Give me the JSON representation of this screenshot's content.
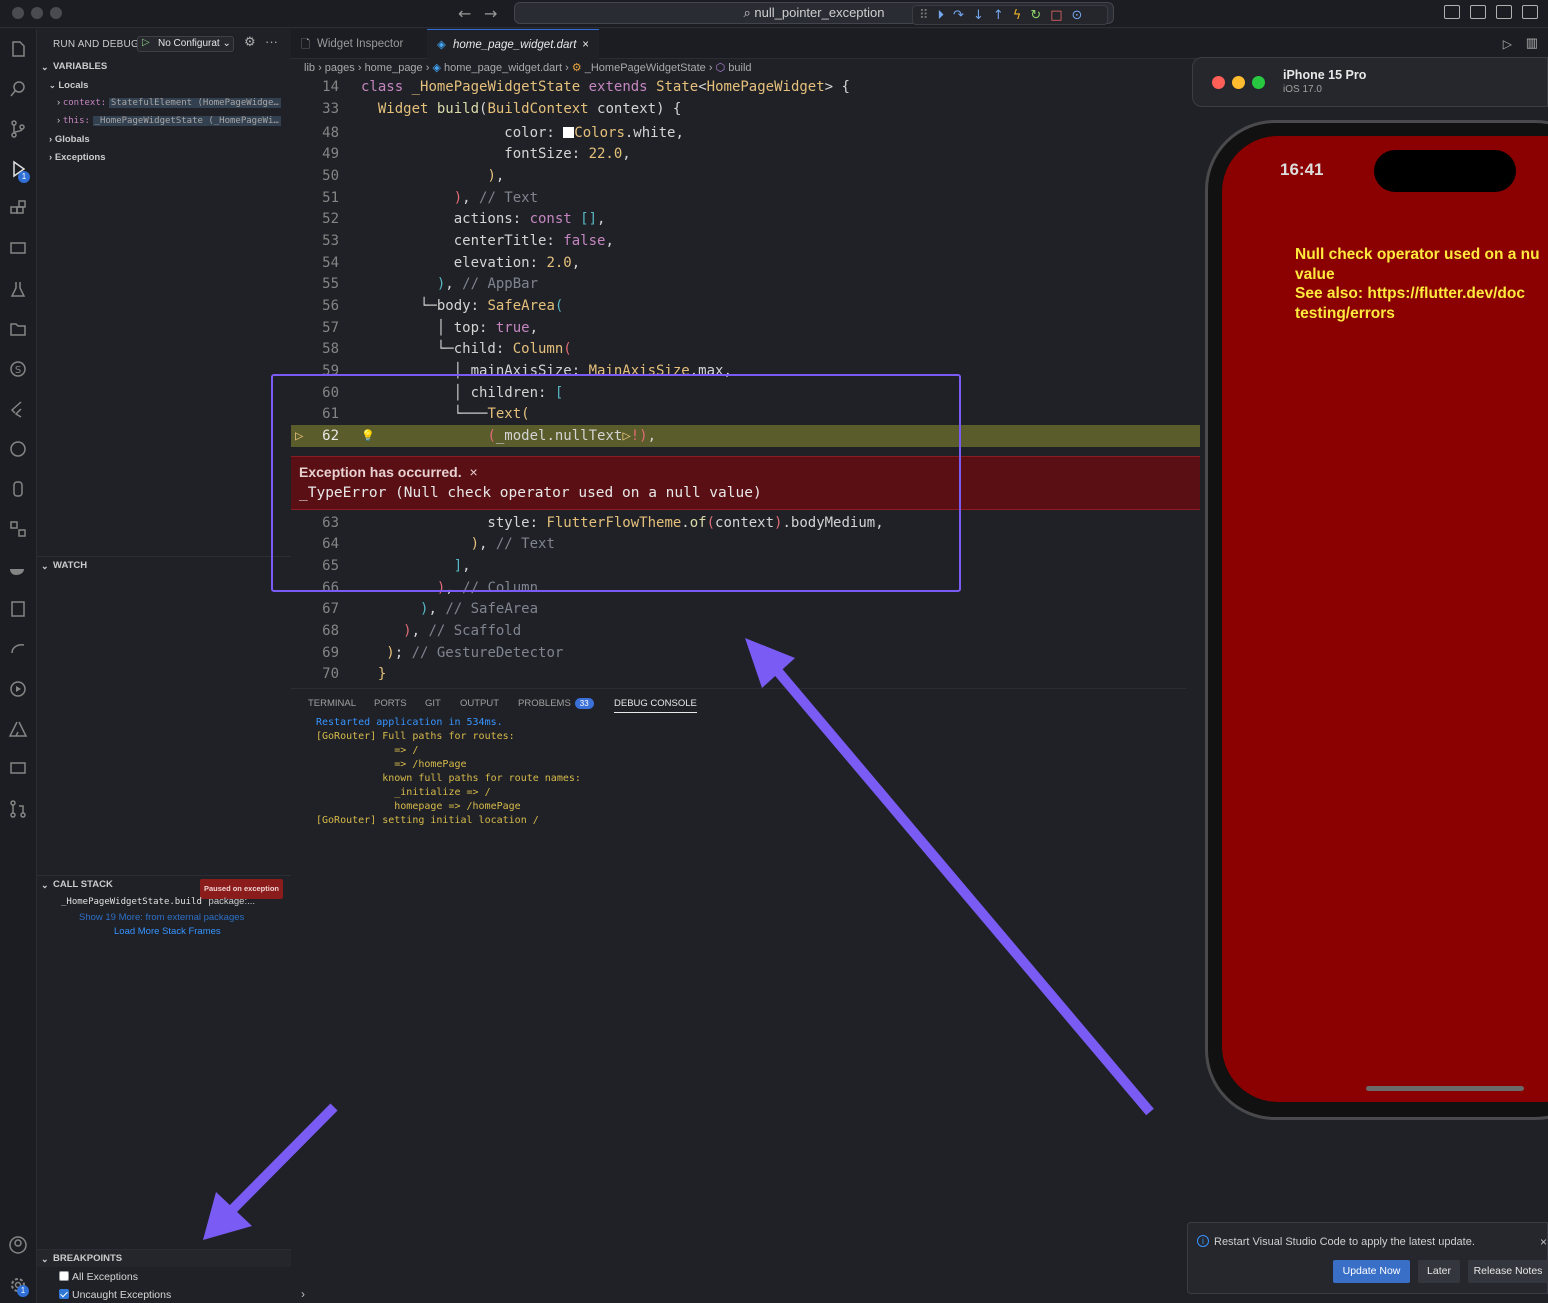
{
  "titlebar": {
    "search_text": "null_pointer_exception",
    "debug_toolbar_icons": [
      "grip-icon",
      "continue-icon",
      "step-over-icon",
      "step-into-icon",
      "step-out-icon",
      "hot-reload-icon",
      "restart-icon",
      "stop-icon",
      "inspect-icon"
    ]
  },
  "sidebar": {
    "title": "RUN AND DEBUG",
    "config": "No Configurat",
    "variables_header": "VARIABLES",
    "locals_label": "Locals",
    "context_key": "context:",
    "context_val": "StatefulElement (HomePageWidge…",
    "this_key": "this:",
    "this_val": "_HomePageWidgetState (_HomePageWi…",
    "globals_label": "Globals",
    "exceptions_label": "Exceptions",
    "watch_header": "WATCH",
    "callstack_header": "CALL STACK",
    "paused_badge": "Paused on exception",
    "frame_fn": "_HomePageWidgetState.build",
    "frame_pkg": "package:...",
    "show_more": "Show 19 More: from external packages",
    "load_more": "Load More Stack Frames",
    "breakpoints_header": "BREAKPOINTS",
    "bp_all": "All Exceptions",
    "bp_uncaught": "Uncaught Exceptions"
  },
  "activity_badges": {
    "debug": "1",
    "settings": "1"
  },
  "tabs": [
    {
      "label": "Widget Inspector"
    },
    {
      "label": "home_page_widget.dart"
    }
  ],
  "breadcrumb": {
    "lib": "lib",
    "pages": "pages",
    "home_page": "home_page",
    "file": "home_page_widget.dart",
    "cls": "_HomePageWidgetState",
    "method": "build"
  },
  "editor": {
    "exception_title": "Exception has occurred.",
    "exception_message": "_TypeError (Null check operator used on a null value)"
  },
  "panel": {
    "tabs": [
      "TERMINAL",
      "PORTS",
      "GIT",
      "OUTPUT",
      "PROBLEMS",
      "DEBUG CONSOLE"
    ],
    "problems_count": "33",
    "console": [
      "Restarted application in 534ms.",
      "[GoRouter] Full paths for routes:",
      "             => /",
      "             => /homePage",
      "           known full paths for route names:",
      "             _initialize => /",
      "             homepage => /homePage",
      "[GoRouter] setting initial location /"
    ]
  },
  "simulator": {
    "device": "iPhone 15 Pro",
    "os": "iOS 17.0",
    "time": "16:41",
    "error_text": "Null check operator used on a nu\nvalue\nSee also: https://flutter.dev/doc\ntesting/errors"
  },
  "notification": {
    "message": "Restart Visual Studio Code to apply the latest update.",
    "update_now": "Update Now",
    "later": "Later",
    "release_notes": "Release Notes"
  },
  "colors": {
    "accent": "#3794ff",
    "annotation": "#7a5cf5",
    "error_bg": "#5a0f14",
    "phone_error_bg": "#8b0000"
  }
}
